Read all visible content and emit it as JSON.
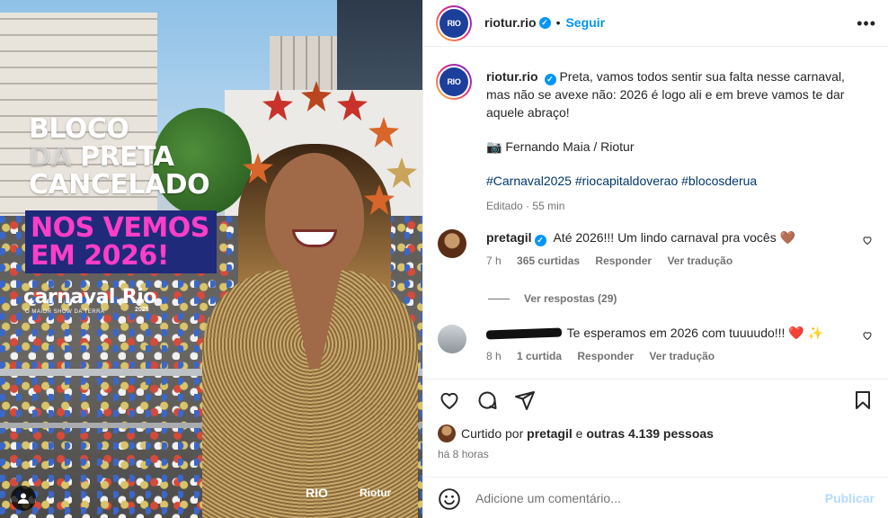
{
  "poster": {
    "title_line1": "BLOCO",
    "title_line2_a": "DA",
    "title_line2_b": "PRETA",
    "title_line3": "CANCELADO",
    "box_line1": "NOS VEMOS",
    "box_line2": "EM 2026!",
    "carnaval_logo": "carnaval.Rio",
    "carnaval_sub": "O MAIOR SHOW DA TERRA",
    "carnaval_year": "2025",
    "footer_logo_1": "RIO",
    "footer_logo_2": "Riotur",
    "accent_pink": "#ff3ec8",
    "box_bg": "#1f2a7a"
  },
  "header": {
    "username": "riotur.rio",
    "avatar_text": "RIO",
    "separator": "•",
    "follow_label": "Seguir",
    "more_icon": "more-horizontal-icon"
  },
  "caption": {
    "username": "riotur.rio",
    "text": "Preta, vamos todos sentir sua falta nesse carnaval, mas não se avexe não: 2026 é logo ali e em breve vamos te dar aquele abraço!",
    "credit_emoji": "📷",
    "credit": "Fernando Maia / Riotur",
    "hashtags": "#Carnaval2025 #riocapitaldoverao #blocosderua",
    "edited": "Editado",
    "edited_sep": "·",
    "time": "55 min"
  },
  "comments": [
    {
      "username": "pretagil",
      "text": "Até 2026!!! Um lindo carnaval pra vocês 🤎",
      "time": "7 h",
      "likes": "365 curtidas",
      "reply_label": "Responder",
      "translate_label": "Ver tradução",
      "replies_label": "Ver respostas (29)"
    },
    {
      "username": "",
      "text": "Te esperamos em 2026 com tuuuudo!!! ❤️ ✨",
      "time": "8 h",
      "likes": "1 curtida",
      "reply_label": "Responder",
      "translate_label": "Ver tradução"
    }
  ],
  "actions": {
    "like_icon": "heart-icon",
    "comment_icon": "comment-icon",
    "share_icon": "send-icon",
    "save_icon": "bookmark-icon"
  },
  "likes": {
    "prefix": "Curtido por",
    "user": "pretagil",
    "conj": "e",
    "others": "outras 4.139 pessoas"
  },
  "posted_time": "há 8 horas",
  "add_comment": {
    "placeholder": "Adicione um comentário...",
    "publish_label": "Publicar"
  },
  "colors": {
    "link_blue": "#0095f6",
    "hashtag_blue": "#00376b",
    "muted": "#737373"
  }
}
